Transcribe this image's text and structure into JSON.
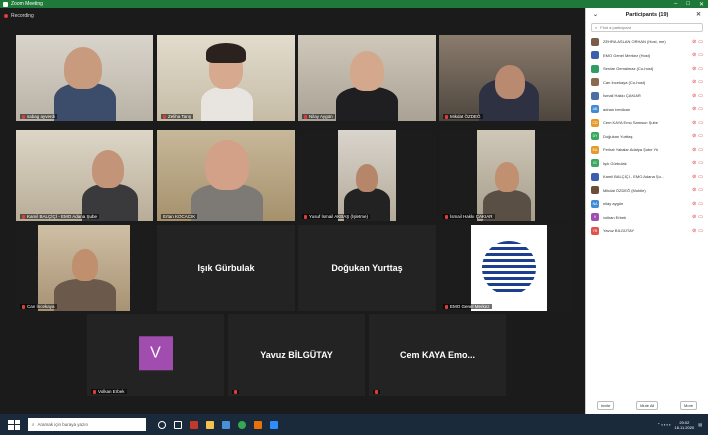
{
  "window": {
    "title": "Zoom Meeting",
    "controls": [
      "–",
      "□",
      "✕"
    ]
  },
  "recording": {
    "label": "Recording",
    "color": "#e23b3b"
  },
  "participants_grid": [
    {
      "name": "sabag ayverdi",
      "type": "video"
    },
    {
      "name": "Zeliha Tarış",
      "type": "video"
    },
    {
      "name": "Nilay Aygün",
      "type": "video"
    },
    {
      "name": "Mikdat ÖZDEĞ",
      "type": "video"
    },
    {
      "name": "Kamil BALÇİÇİ - EMO Adana Şube",
      "type": "video"
    },
    {
      "name": "Ertan KOCACIK",
      "type": "video",
      "active": true
    },
    {
      "name": "Yusuf İsmail AKBAŞ (İşletme)",
      "type": "video"
    },
    {
      "name": "İsmail Hakkı ÇAKIAR",
      "type": "video"
    },
    {
      "name": "Can İncekaya",
      "type": "video"
    },
    {
      "name": "Işık Gürbulak",
      "type": "name"
    },
    {
      "name": "Doğukan Yurttaş",
      "type": "name"
    },
    {
      "name": "EMO Genel Merkez",
      "type": "logo"
    },
    {
      "name": "Volkan Erbek",
      "type": "avatar",
      "initial": "V"
    },
    {
      "name": "Yavuz BİLGÜTAY",
      "type": "name"
    },
    {
      "name": "Cem KAYA Emo...",
      "type": "name"
    }
  ],
  "panel": {
    "title": "Participants (19)",
    "search_placeholder": "Find a participant",
    "list": [
      {
        "initials": "",
        "name": "ZEHRA ASLAN ORHAN (Host, me)",
        "color": "#7a5c4c"
      },
      {
        "initials": "",
        "name": "EMO Genel Merkez (Host)",
        "color": "#3b5fb0"
      },
      {
        "initials": "",
        "name": "Serdar Gemalmaz (Co-host)",
        "color": "#2e9e63"
      },
      {
        "initials": "",
        "name": "Can İncekaya (Co-host)",
        "color": "#8a6a4e"
      },
      {
        "initials": "",
        "name": "İsmail Hakkı ÇAKIAR",
        "color": "#4a6fa5"
      },
      {
        "initials": "AB",
        "name": "adnan benlican",
        "color": "#3f8bd6"
      },
      {
        "initials": "CD",
        "name": "Cem KAYA Emo Samsun Şube",
        "color": "#e59b2c"
      },
      {
        "initials": "DY",
        "name": "Doğukan Yurttaş",
        "color": "#37a85c"
      },
      {
        "initials": "EA",
        "name": "Ferhat Yakalar Adalya Şube Yk",
        "color": "#e59b2c"
      },
      {
        "initials": "IG",
        "name": "Işık Gürbulak",
        "color": "#37a85c"
      },
      {
        "initials": "",
        "name": "Kamil BALÇİÇİ - EMO Adana Şu...",
        "color": "#3b5fb0"
      },
      {
        "initials": "",
        "name": "Mikdat ÖZDEĞ (Mobile)",
        "color": "#6b4e38"
      },
      {
        "initials": "NA",
        "name": "nilay aygün",
        "color": "#3f8bd6"
      },
      {
        "initials": "V",
        "name": "volkan Erbek",
        "color": "#a14db0"
      },
      {
        "initials": "YB",
        "name": "Yavuz BİLGÜTAY",
        "color": "#e0524a"
      }
    ],
    "footer": {
      "invite": "Invite",
      "mute_all": "Mute All",
      "more": "More"
    }
  },
  "taskbar": {
    "search_placeholder": "Aramak için buraya yazın",
    "time": "20:02",
    "date": "16.11.2020"
  }
}
